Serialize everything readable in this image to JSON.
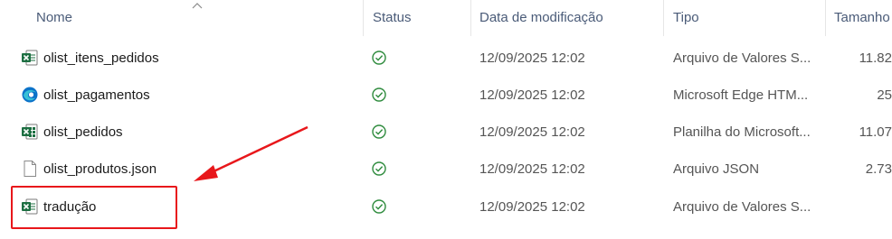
{
  "columns": {
    "name": "Nome",
    "status": "Status",
    "date": "Data de modificação",
    "type": "Tipo",
    "size": "Tamanho"
  },
  "files": [
    {
      "name": "olist_itens_pedidos",
      "icon": "excel-csv-icon",
      "status": "synced-check-icon",
      "date": "12/09/2025 12:02",
      "type": "Arquivo de Valores S...",
      "size": "11.82"
    },
    {
      "name": "olist_pagamentos",
      "icon": "edge-html-icon",
      "status": "synced-check-icon",
      "date": "12/09/2025 12:02",
      "type": "Microsoft Edge HTM...",
      "size": "25"
    },
    {
      "name": "olist_pedidos",
      "icon": "excel-sheet-icon",
      "status": "synced-check-icon",
      "date": "12/09/2025 12:02",
      "type": "Planilha do Microsoft...",
      "size": "11.07"
    },
    {
      "name": "olist_produtos.json",
      "icon": "json-file-icon",
      "status": "synced-check-icon",
      "date": "12/09/2025 12:02",
      "type": "Arquivo JSON",
      "size": "2.73"
    },
    {
      "name": "tradução",
      "icon": "excel-csv-icon",
      "status": "synced-check-icon",
      "date": "12/09/2025 12:02",
      "type": "Arquivo de Valores S...",
      "size": ""
    }
  ],
  "colors": {
    "annotation": "#e8171b",
    "excel_green": "#1d6f42",
    "status_green": "#2e8b3d"
  }
}
